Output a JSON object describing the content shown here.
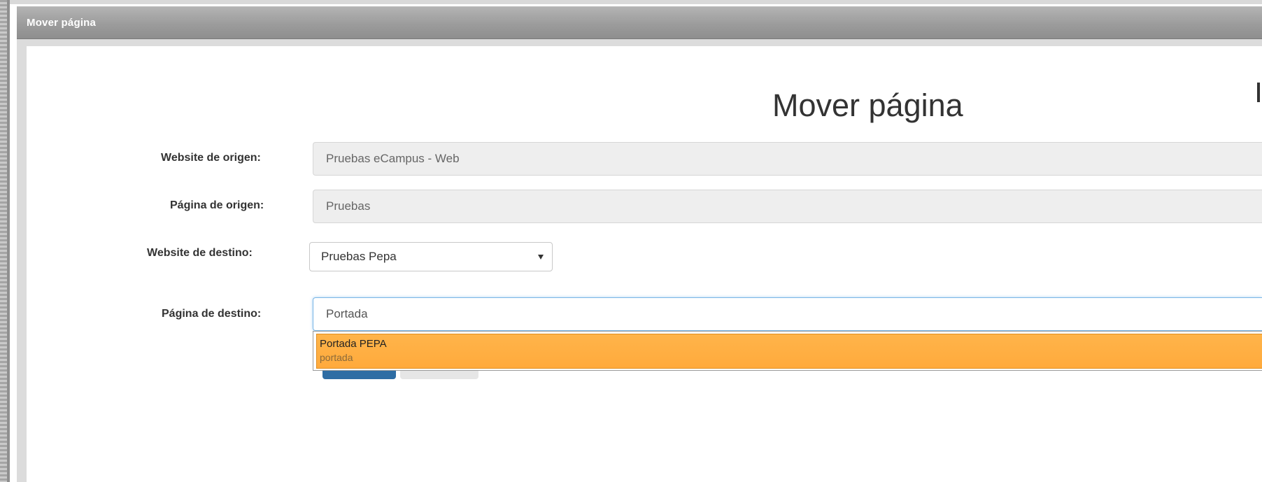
{
  "window": {
    "title": "Mover página"
  },
  "page": {
    "heading": "Mover página"
  },
  "form": {
    "source_website": {
      "label": "Website de origen:",
      "value": "Pruebas eCampus - Web"
    },
    "source_page": {
      "label": "Página de origen:",
      "value": "Pruebas"
    },
    "target_website": {
      "label": "Website de destino:",
      "selected": "Pruebas Pepa"
    },
    "target_page": {
      "label": "Página de destino:",
      "value": "Portada"
    }
  },
  "autocomplete": {
    "items": [
      {
        "title": "Portada PEPA",
        "subtitle": "portada"
      }
    ],
    "highlight_color": "#ffad3f"
  },
  "colors": {
    "titlebar": "#9c9c9c",
    "primary_button": "#2e6da4",
    "focus_border": "#7ab6e6"
  }
}
